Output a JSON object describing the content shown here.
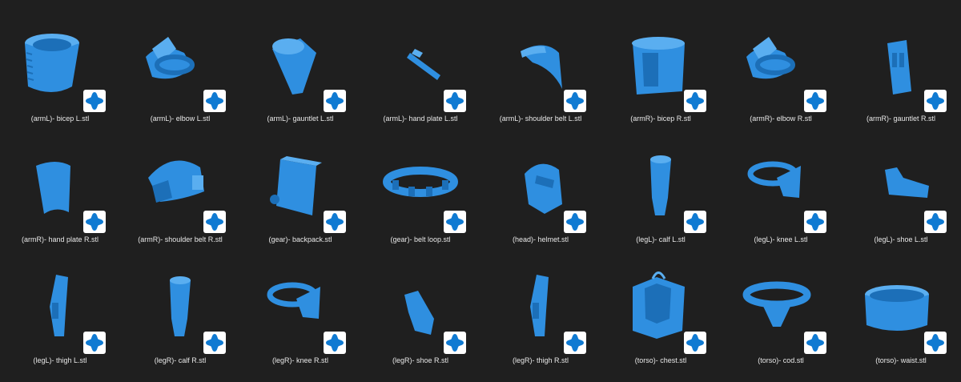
{
  "colors": {
    "background": "#1f1f1f",
    "model": "#2f8fe0",
    "badge_bg": "#ffffff",
    "badge_icon": "#0f7ad2"
  },
  "files": [
    {
      "name": "(armL)- bicep L.stl",
      "shape": "cylinder-ribbed"
    },
    {
      "name": "(armL)- elbow L.stl",
      "shape": "ring-plate"
    },
    {
      "name": "(armL)- gauntlet L.stl",
      "shape": "cone-tube"
    },
    {
      "name": "(armL)- hand plate L.stl",
      "shape": "bar"
    },
    {
      "name": "(armL)- shoulder belt L.stl",
      "shape": "curved-plate"
    },
    {
      "name": "(armR)- bicep R.stl",
      "shape": "cylinder-panel"
    },
    {
      "name": "(armR)- elbow R.stl",
      "shape": "ring-plate"
    },
    {
      "name": "(armR)- gauntlet R.stl",
      "shape": "gauntlet"
    },
    {
      "name": "(armR)- hand plate R.stl",
      "shape": "curved-panel"
    },
    {
      "name": "(armR)- shoulder belt R.stl",
      "shape": "shoulder"
    },
    {
      "name": "(gear)- backpack.stl",
      "shape": "backpack"
    },
    {
      "name": "(gear)- belt loop.stl",
      "shape": "belt"
    },
    {
      "name": "(head)- helmet.stl",
      "shape": "helmet"
    },
    {
      "name": "(legL)- calf L.stl",
      "shape": "calf"
    },
    {
      "name": "(legL)- knee L.stl",
      "shape": "knee"
    },
    {
      "name": "(legL)- shoe L.stl",
      "shape": "shoe"
    },
    {
      "name": "(legL)- thigh L.stl",
      "shape": "thigh"
    },
    {
      "name": "(legR)- calf R.stl",
      "shape": "calf"
    },
    {
      "name": "(legR)- knee R.stl",
      "shape": "knee"
    },
    {
      "name": "(legR)- shoe R.stl",
      "shape": "shoe-vertical"
    },
    {
      "name": "(legR)- thigh R.stl",
      "shape": "thigh"
    },
    {
      "name": "(torso)- chest.stl",
      "shape": "chest"
    },
    {
      "name": "(torso)- cod.stl",
      "shape": "cod"
    },
    {
      "name": "(torso)- waist.stl",
      "shape": "waist"
    }
  ],
  "badge": {
    "icon": "3d-viewer-icon"
  }
}
